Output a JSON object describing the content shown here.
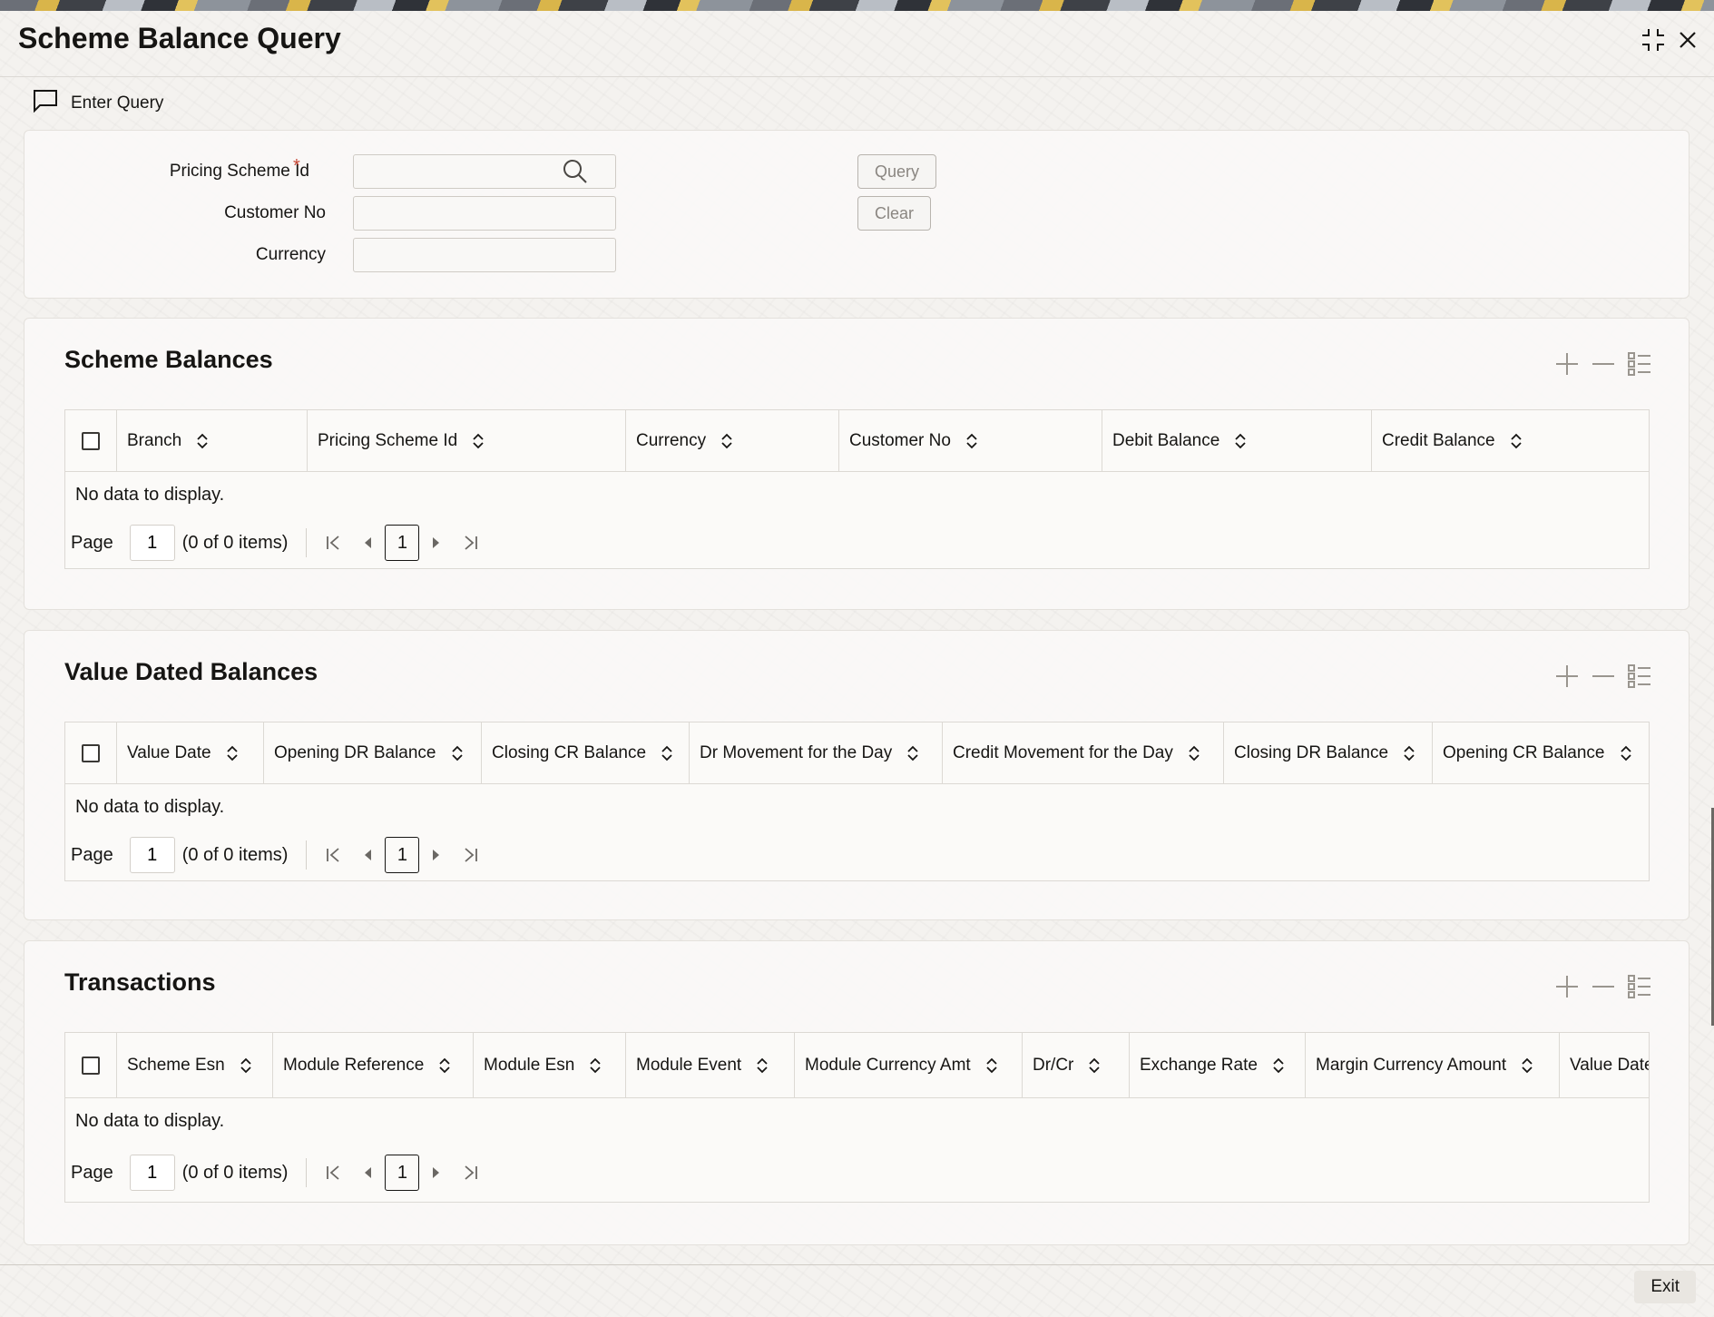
{
  "window": {
    "title": "Scheme Balance Query"
  },
  "toolbar": {
    "enter_query_label": "Enter Query"
  },
  "form": {
    "pricing_scheme_id": {
      "label": "Pricing Scheme Id",
      "required_mark": "*",
      "value": ""
    },
    "customer_no": {
      "label": "Customer No",
      "value": ""
    },
    "currency": {
      "label": "Currency",
      "value": ""
    },
    "query_button": "Query",
    "clear_button": "Clear"
  },
  "scheme_balances": {
    "title": "Scheme Balances",
    "columns": [
      "Branch",
      "Pricing Scheme Id",
      "Currency",
      "Customer No",
      "Debit Balance",
      "Credit Balance"
    ],
    "rows": [],
    "empty_text": "No data to display.",
    "pager": {
      "label": "Page",
      "page": "1",
      "count_text": "(0 of 0 items)",
      "current": "1"
    }
  },
  "value_dated_balances": {
    "title": "Value Dated Balances",
    "columns": [
      "Value Date",
      "Opening DR Balance",
      "Closing CR Balance",
      "Dr Movement for the Day",
      "Credit Movement for the Day",
      "Closing DR Balance",
      "Opening CR Balance"
    ],
    "rows": [],
    "empty_text": "No data to display.",
    "pager": {
      "label": "Page",
      "page": "1",
      "count_text": "(0 of 0 items)",
      "current": "1"
    }
  },
  "transactions": {
    "title": "Transactions",
    "columns": [
      "Scheme Esn",
      "Module Reference",
      "Module Esn",
      "Module Event",
      "Module Currency Amt",
      "Dr/Cr",
      "Exchange Rate",
      "Margin Currency Amount",
      "Value Date"
    ],
    "rows": [],
    "empty_text": "No data to display.",
    "pager": {
      "label": "Page",
      "page": "1",
      "count_text": "(0 of 0 items)",
      "current": "1"
    }
  },
  "footer": {
    "exit_button": "Exit"
  },
  "icons": {
    "minimize": "collapse-icon",
    "close": "close-icon",
    "query": "comment-icon",
    "search": "search-icon",
    "add_row": "plus-icon",
    "delete_row": "minus-icon",
    "single_record_view": "list-view-icon",
    "sort": "sort-icon",
    "first_page": "first-page-icon",
    "prev_page": "prev-page-icon",
    "next_page": "next-page-icon",
    "last_page": "last-page-icon"
  },
  "colors": {
    "required": "#c74634",
    "text": "#161513",
    "disabled_text": "#8a8681"
  }
}
